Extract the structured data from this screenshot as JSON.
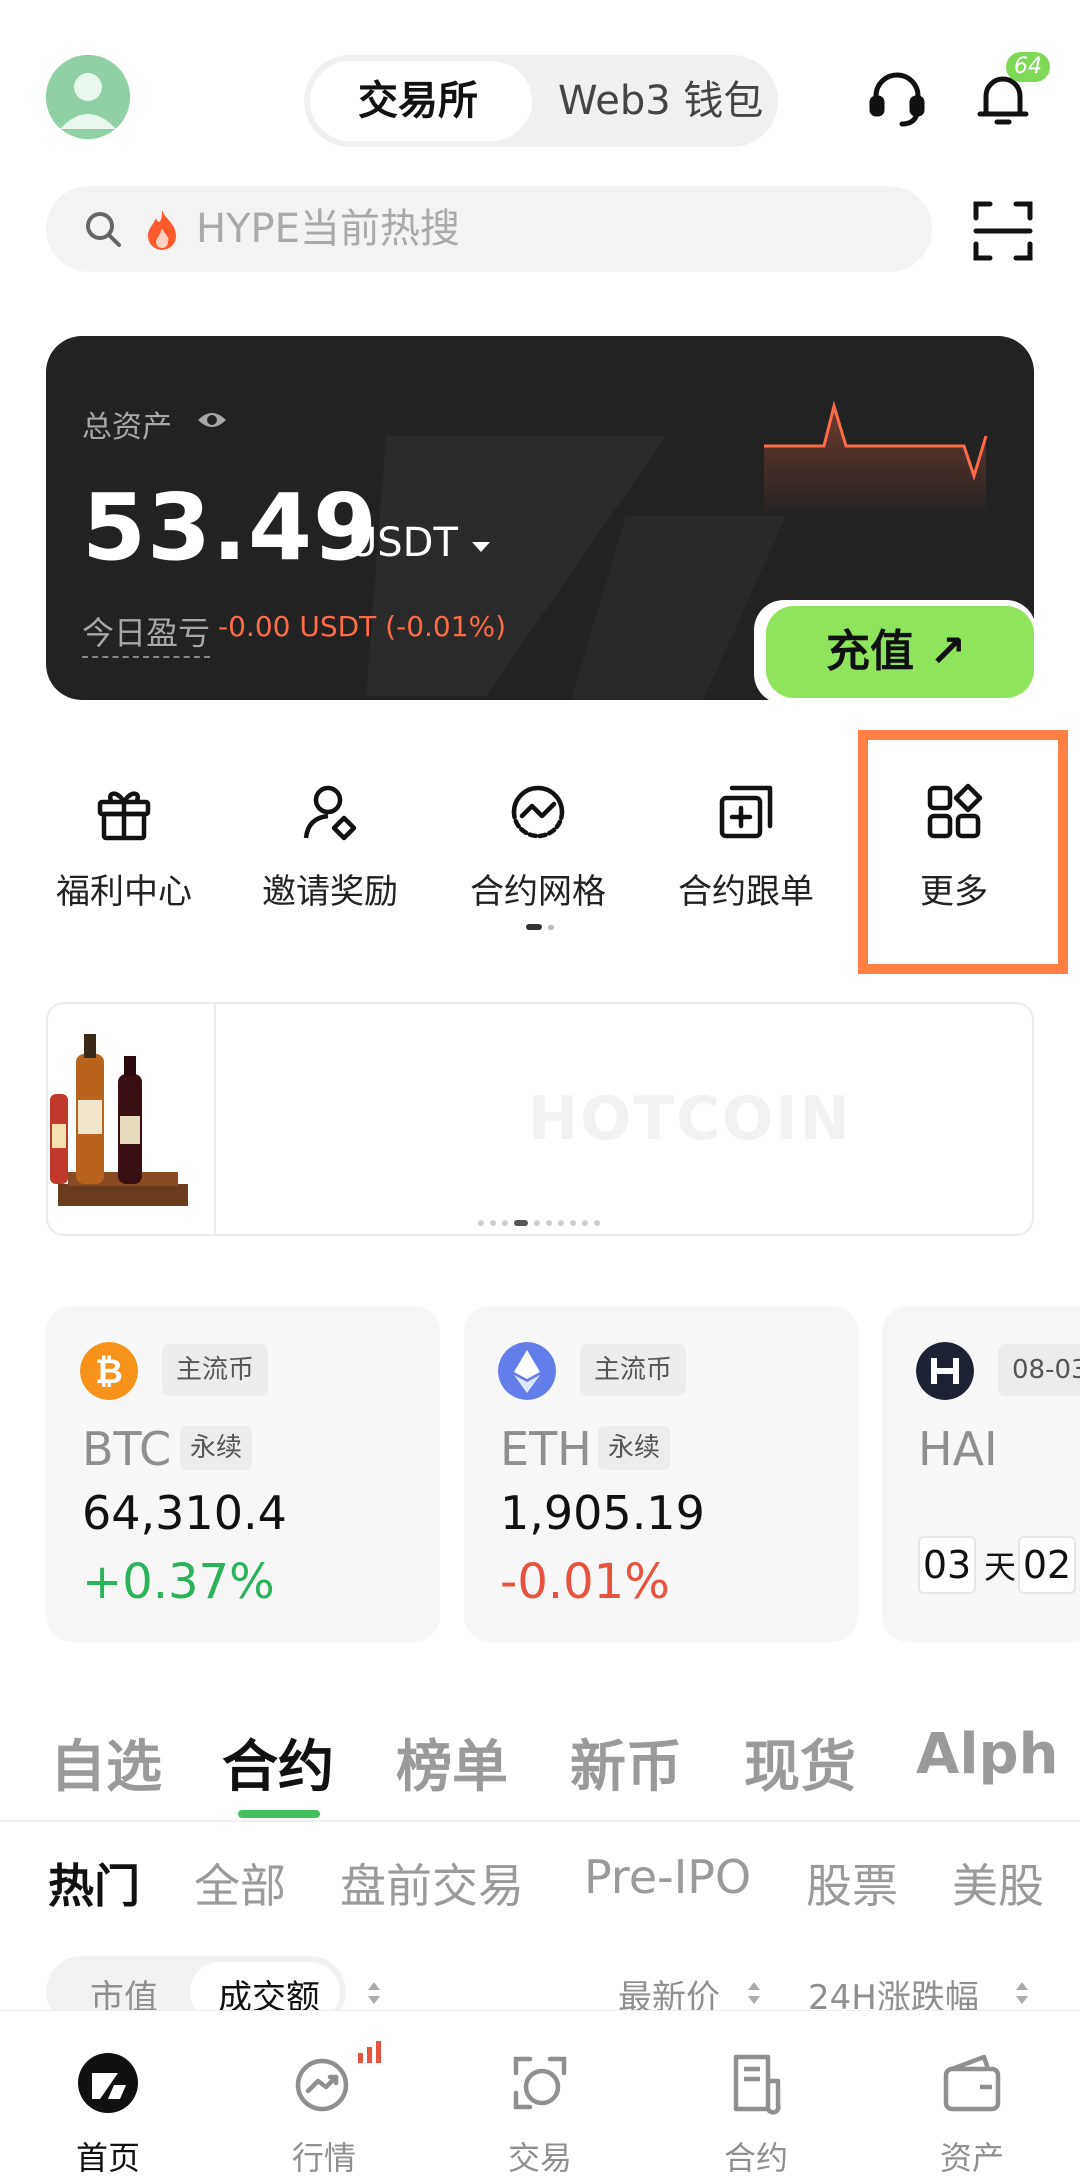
{
  "header": {
    "segment": {
      "active_label": "交易所",
      "other_label": "Web3 钱包"
    },
    "notification_count": "64"
  },
  "search": {
    "placeholder": "HYPE当前热搜"
  },
  "asset_card": {
    "label": "总资产",
    "value": "53.49",
    "unit": "USDT",
    "pnl_label": "今日盈亏",
    "pnl_value": "-0.00 USDT (-0.01%)",
    "deposit_label": "充值 ↗"
  },
  "quick_actions": [
    {
      "label": "福利中心",
      "icon": "gift-icon"
    },
    {
      "label": "邀请奖励",
      "icon": "invite-user-icon"
    },
    {
      "label": "合约网格",
      "icon": "grid-wave-icon"
    },
    {
      "label": "合约跟单",
      "icon": "copy-trade-icon"
    },
    {
      "label": "更多",
      "icon": "apps-grid-icon"
    }
  ],
  "banner": {
    "watermark": "HOTCOIN"
  },
  "market_cards": [
    {
      "category": "主流币",
      "symbol": "BTC",
      "perp": "永续",
      "price": "64,310.4",
      "change": "+0.37%",
      "coin_color": "#f7931a"
    },
    {
      "category": "主流币",
      "symbol": "ETH",
      "perp": "永续",
      "price": "1,905.19",
      "change": "-0.01%",
      "coin_color": "#627eea"
    },
    {
      "category": "08-03",
      "symbol": "HAI",
      "countdown": {
        "days": "03",
        "day_unit": "天",
        "hours": "02"
      }
    }
  ],
  "category_tabs": [
    "自选",
    "合约",
    "榜单",
    "新币",
    "现货",
    "Alph"
  ],
  "sub_tabs": [
    "热门",
    "全部",
    "盘前交易",
    "Pre-IPO",
    "股票",
    "美股"
  ],
  "sort_row": {
    "market_cap": "市值",
    "volume": "成交额",
    "latest_price": "最新价",
    "change_24h": "24H涨跌幅"
  },
  "bottom_nav": [
    {
      "label": "首页",
      "icon": "home-logo-icon"
    },
    {
      "label": "行情",
      "icon": "market-trend-icon"
    },
    {
      "label": "交易",
      "icon": "trade-icon"
    },
    {
      "label": "合约",
      "icon": "contract-doc-icon"
    },
    {
      "label": "资产",
      "icon": "wallet-icon"
    }
  ],
  "colors": {
    "accent_green": "#8ee45c",
    "up": "#2bb35c",
    "down": "#e8533f",
    "highlight": "#ff7f44"
  }
}
